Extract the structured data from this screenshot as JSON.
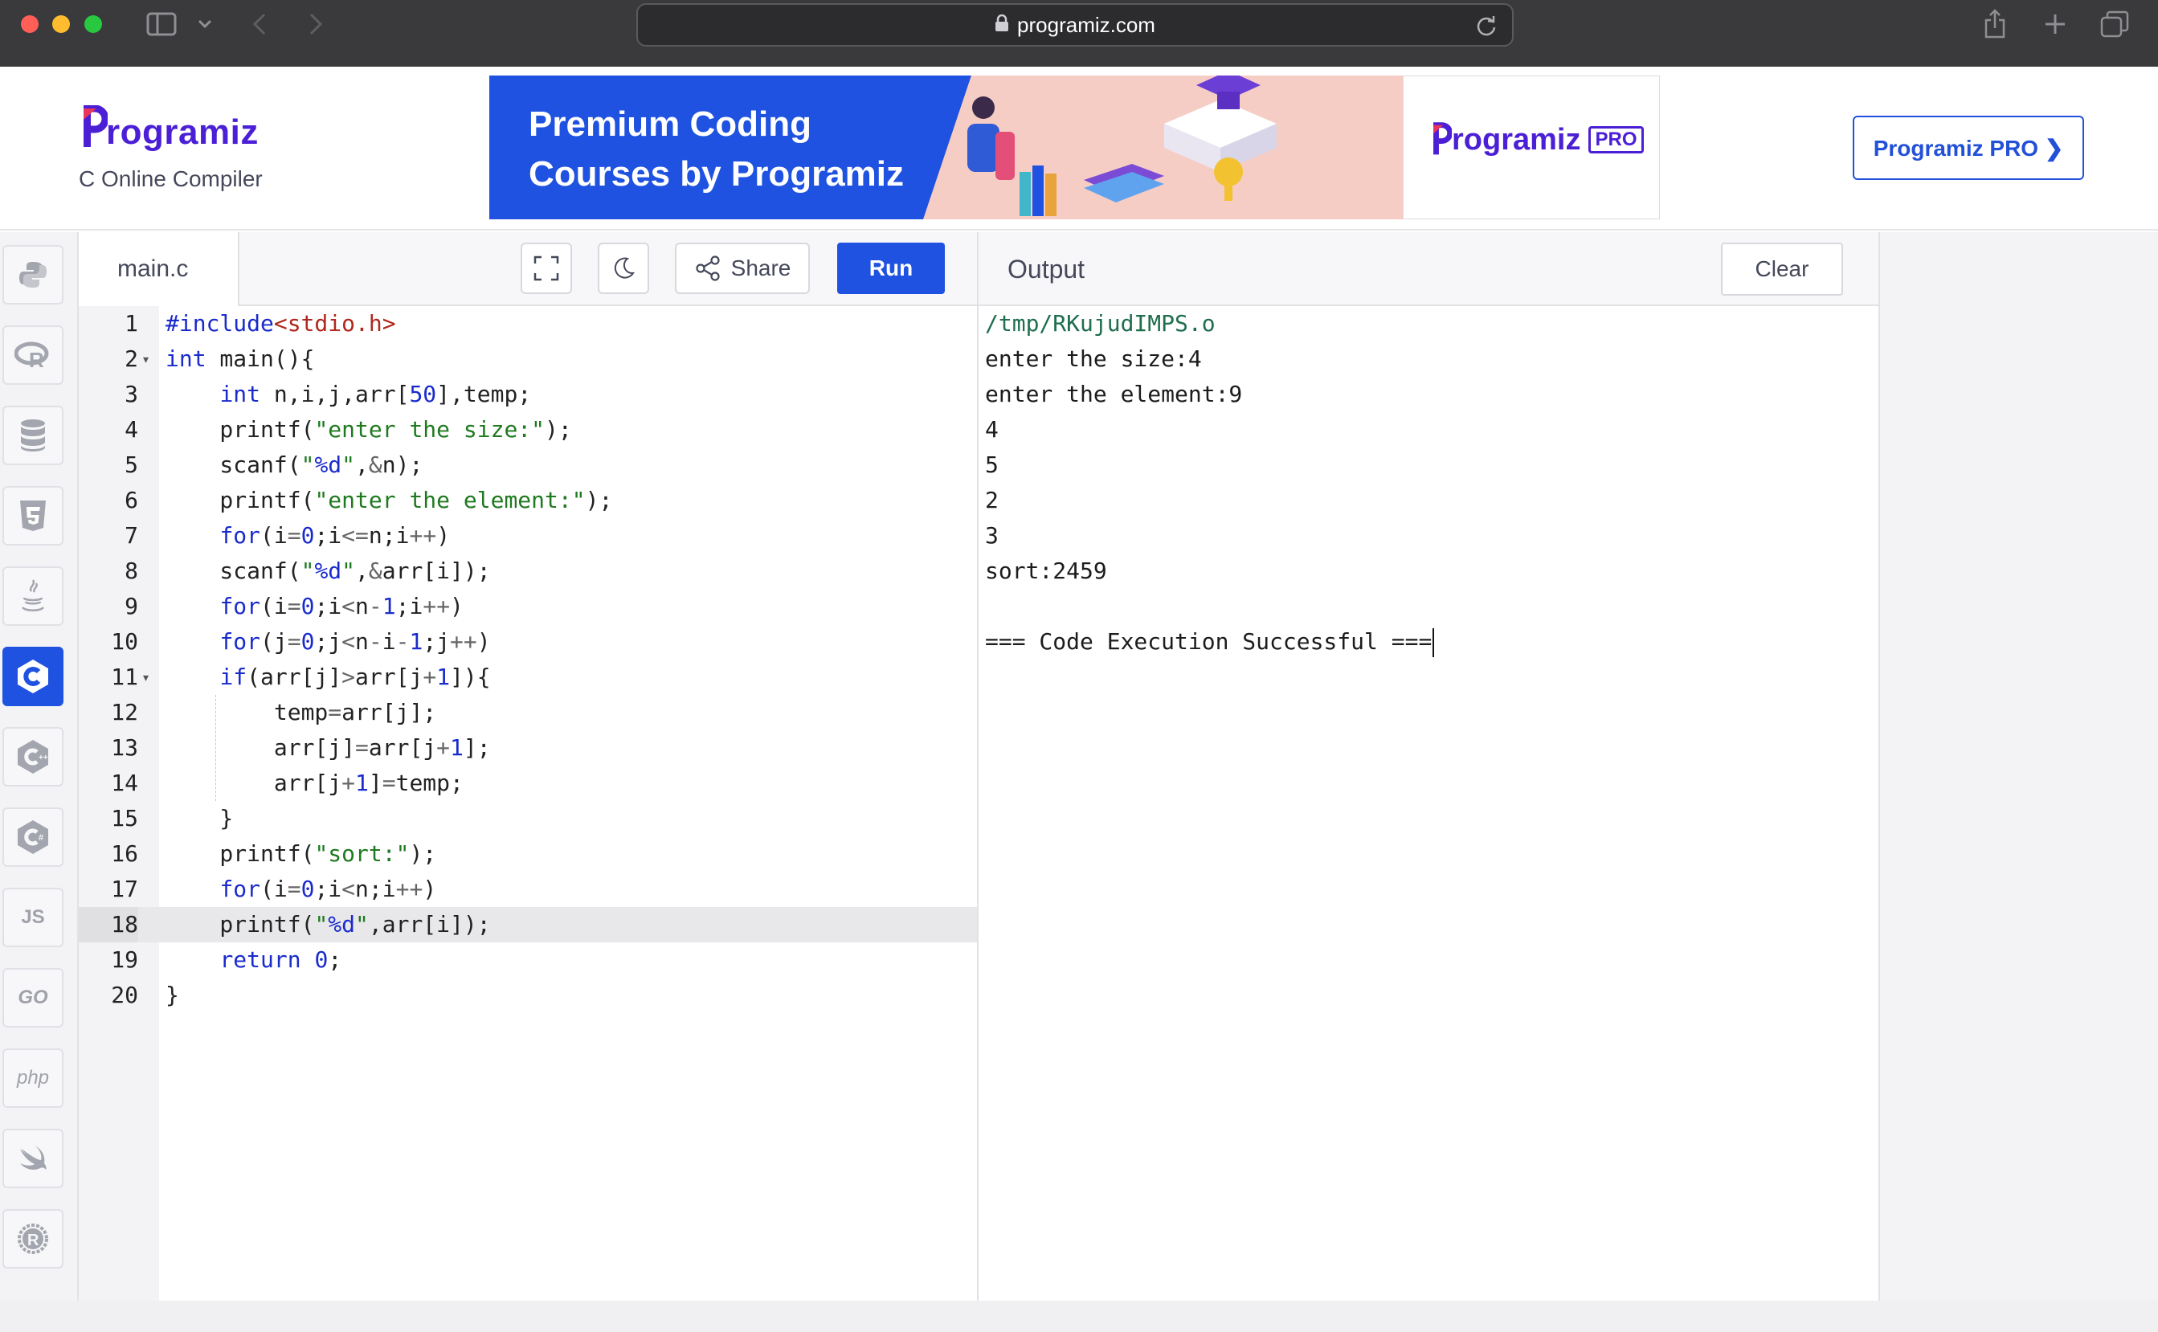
{
  "browser": {
    "url": "programiz.com",
    "colors": {
      "chrome": "#3a3a3c",
      "close": "#ff5f57",
      "minimize": "#febc2e",
      "zoom": "#28c840"
    }
  },
  "header": {
    "logo_text": "rogramiz",
    "subtitle": "C Online Compiler",
    "banner": {
      "line1": "Premium Coding",
      "line2": "Courses by Programiz",
      "logo_text": "rogramiz",
      "pro_tag": "PRO"
    },
    "pro_button": "Programiz PRO ❯",
    "colors": {
      "brand": "#4b1fd6",
      "accent": "#1f52e0"
    }
  },
  "rail": {
    "items": [
      {
        "name": "python",
        "icon": "python-icon",
        "active": false
      },
      {
        "name": "r",
        "icon": "r-icon",
        "active": false
      },
      {
        "name": "sql",
        "icon": "database-icon",
        "active": false
      },
      {
        "name": "html",
        "icon": "html5-icon",
        "active": false
      },
      {
        "name": "java",
        "icon": "java-icon",
        "active": false
      },
      {
        "name": "c",
        "icon": "c-icon",
        "active": true
      },
      {
        "name": "cpp",
        "icon": "cpp-icon",
        "active": false
      },
      {
        "name": "csharp",
        "icon": "csharp-icon",
        "active": false
      },
      {
        "name": "js",
        "icon": "js-icon",
        "label": "JS",
        "active": false
      },
      {
        "name": "go",
        "icon": "go-icon",
        "label": "GO",
        "active": false
      },
      {
        "name": "php",
        "icon": "php-icon",
        "label": "php",
        "active": false
      },
      {
        "name": "swift",
        "icon": "swift-icon",
        "active": false
      },
      {
        "name": "rust",
        "icon": "rust-icon",
        "active": false
      }
    ]
  },
  "editor": {
    "file_name": "main.c",
    "share_label": "Share",
    "run_label": "Run",
    "active_line": 18,
    "lines": [
      "#include<stdio.h>",
      "int main(){",
      "    int n,i,j,arr[50],temp;",
      "    printf(\"enter the size:\");",
      "    scanf(\"%d\",&n);",
      "    printf(\"enter the element:\");",
      "    for(i=0;i<=n;i++)",
      "    scanf(\"%d\",&arr[i]);",
      "    for(i=0;i<n-1;i++)",
      "    for(j=0;j<n-i-1;j++)",
      "    if(arr[j]>arr[j+1]){",
      "        temp=arr[j];",
      "        arr[j]=arr[j+1];",
      "        arr[j+1]=temp;",
      "    }",
      "    printf(\"sort:\");",
      "    for(i=0;i<n;i++)",
      "    printf(\"%d\",arr[i]);",
      "    return 0;",
      "}"
    ],
    "fold_lines": [
      2,
      11
    ]
  },
  "output": {
    "title": "Output",
    "clear_label": "Clear",
    "lines": [
      "/tmp/RKujudIMPS.o",
      "enter the size:4",
      "enter the element:9",
      "4",
      "5",
      "2",
      "3",
      "sort:2459",
      "",
      "=== Code Execution Successful ==="
    ]
  }
}
